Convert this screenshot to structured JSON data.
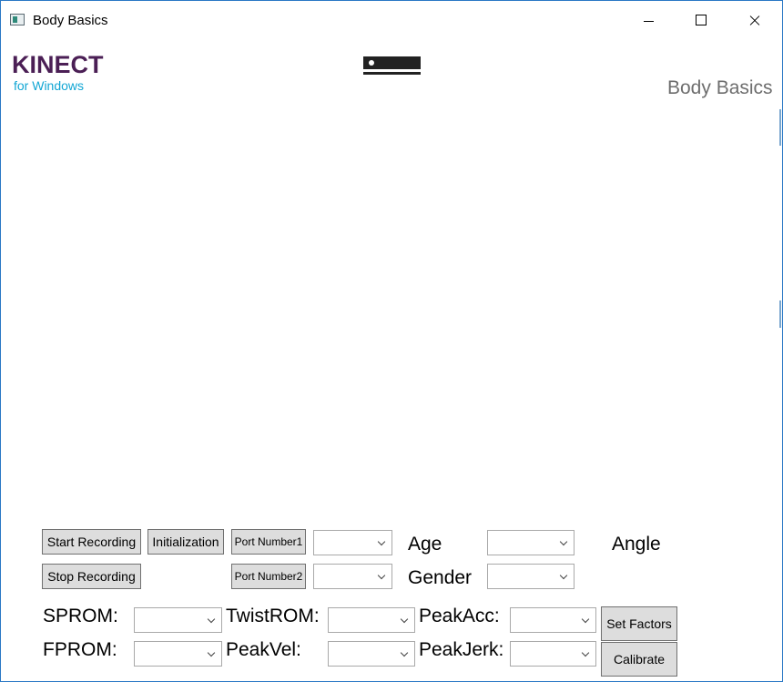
{
  "window": {
    "title": "Body Basics",
    "controls": [
      "minimize-icon",
      "maximize-icon",
      "close-icon"
    ]
  },
  "header": {
    "logo_main": "KINECT",
    "logo_sub": "for Windows",
    "title": "Body Basics",
    "sensor_icon": "kinect-sensor-icon"
  },
  "colors": {
    "logo_main": "#4b1f55",
    "logo_sub": "#11a6d4",
    "window_border": "#2b78c5",
    "button_bg": "#dddddd"
  },
  "controls": {
    "start_recording": "Start Recording",
    "stop_recording": "Stop Recording",
    "initialization": "Initialization",
    "port_number1": "Port Number1",
    "port_number2": "Port Number2",
    "age_label": "Age",
    "gender_label": "Gender",
    "angle_label": "Angle",
    "sprom_label": "SPROM:",
    "fprom_label": "FPROM:",
    "twistrom_label": "TwistROM:",
    "peakvel_label": "PeakVel:",
    "peakacc_label": "PeakAcc:",
    "peakjerk_label": "PeakJerk:",
    "set_factors": "Set Factors",
    "calibrate": "Calibrate"
  }
}
